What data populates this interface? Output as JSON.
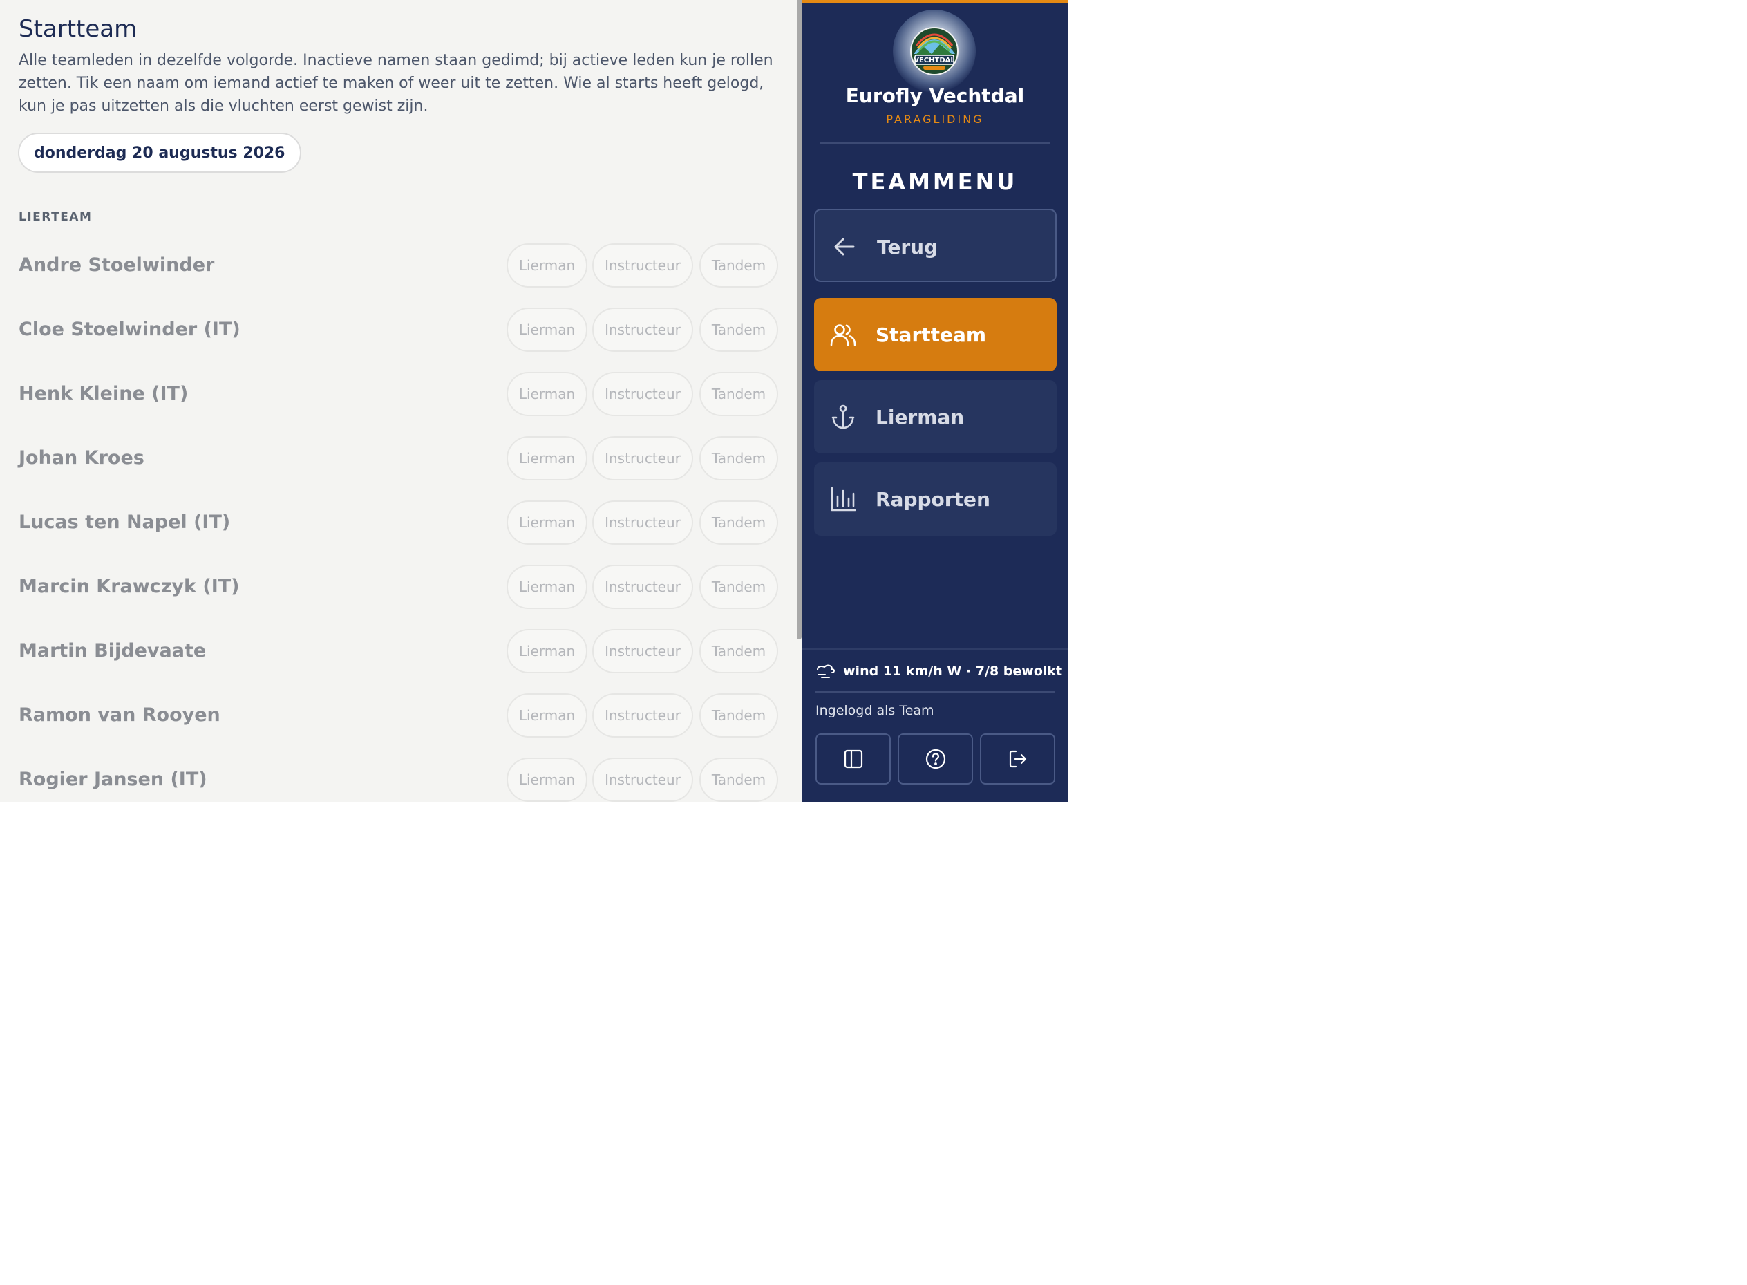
{
  "main": {
    "title": "Startteam",
    "intro": "Alle teamleden in dezelfde volgorde. Inactieve namen staan gedimd; bij actieve leden kun je rollen zetten. Tik een naam om iemand actief te maken of weer uit te zetten. Wie al starts heeft gelogd, kun je pas uitzetten als die vluchten eerst gewist zijn.",
    "date": "donderdag 20 augustus 2026",
    "section_label": "LIERTEAM",
    "roles": [
      "Lierman",
      "Instructeur",
      "Tandem"
    ],
    "members": [
      {
        "name": "Andre Stoelwinder"
      },
      {
        "name": "Cloe Stoelwinder (IT)"
      },
      {
        "name": "Henk Kleine (IT)"
      },
      {
        "name": "Johan Kroes"
      },
      {
        "name": "Lucas ten Napel (IT)"
      },
      {
        "name": "Marcin Krawczyk (IT)"
      },
      {
        "name": "Martin Bijdevaate"
      },
      {
        "name": "Ramon van Rooyen"
      },
      {
        "name": "Rogier Jansen (IT)"
      }
    ]
  },
  "sidebar": {
    "logo_text": "VECHTDAL",
    "brand_name": "Eurofly Vechtdal",
    "brand_sub": "PARAGLIDING",
    "menu_title": "TEAMMENU",
    "nav": [
      {
        "label": "Terug",
        "icon": "arrow-left-icon"
      },
      {
        "label": "Startteam",
        "icon": "users-icon"
      },
      {
        "label": "Lierman",
        "icon": "anchor-icon"
      },
      {
        "label": "Rapporten",
        "icon": "bar-chart-icon"
      }
    ],
    "weather": "wind 11 km/h W · 7/8 bewolkt",
    "logged_in": "Ingelogd als Team",
    "footer_buttons": [
      "sidebar-toggle-icon",
      "help-icon",
      "logout-icon"
    ]
  },
  "colors": {
    "sidebar_bg": "#1d2b57",
    "accent": "#d67c10",
    "main_bg": "#f4f4f2",
    "title": "#1d2b54"
  }
}
